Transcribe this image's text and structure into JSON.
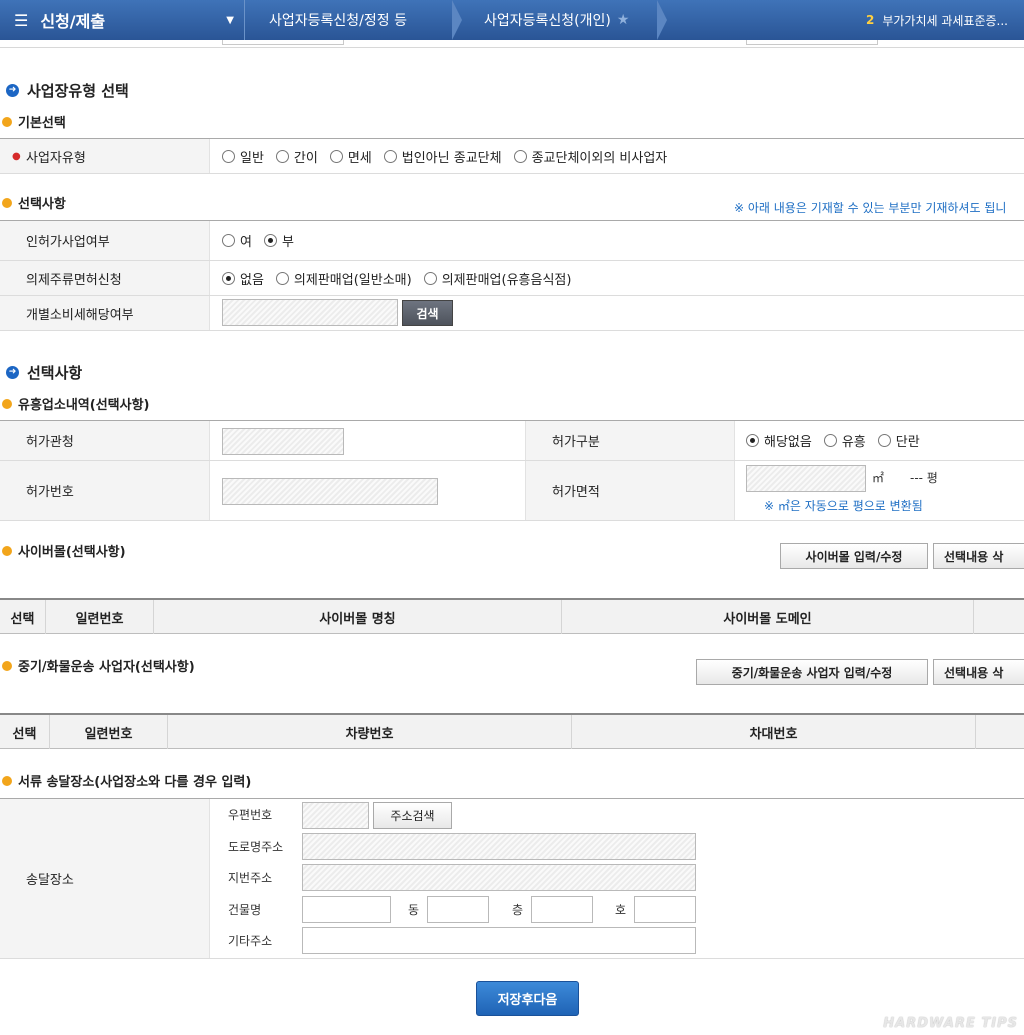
{
  "topbar": {
    "menu": "신청/제출",
    "crumb1": "사업자등록신청/정정 등",
    "crumb2": "사업자등록신청(개인)",
    "notice_num": "2",
    "notice_text": "부가가치세 과세표준증..."
  },
  "section1": {
    "title": "사업장유형 선택",
    "basic": "기본선택",
    "biz_type_label": "사업자유형",
    "biz_type_options": [
      "일반",
      "간이",
      "면세",
      "법인아닌 종교단체",
      "종교단체이외의 비사업자"
    ],
    "select_title": "선택사항",
    "select_note": "※ 아래 내용은 기재할 수 있는 부분만 기재하셔도 됩니",
    "license_label": "인허가사업여부",
    "license_opts": [
      "여",
      "부"
    ],
    "liquor_label": "의제주류면허신청",
    "liquor_opts": [
      "없음",
      "의제판매업(일반소매)",
      "의제판매업(유흥음식점)"
    ],
    "excise_label": "개별소비세해당여부",
    "search_btn": "검색"
  },
  "section2": {
    "title": "선택사항",
    "ent_title": "유흥업소내역(선택사항)",
    "agency_label": "허가관청",
    "permit_type_label": "허가구분",
    "permit_type_opts": [
      "해당없음",
      "유흥",
      "단란"
    ],
    "permit_no_label": "허가번호",
    "permit_area_label": "허가면적",
    "area_unit": "㎡",
    "pyeong": "--- 평",
    "area_note": "※ ㎡은 자동으로 평으로 변환됨",
    "cyber_title": "사이버몰(선택사항)",
    "cyber_btn": "사이버몰 입력/수정",
    "delete_btn": "선택내용 삭",
    "cyber_cols": [
      "선택",
      "일련번호",
      "사이버몰 명칭",
      "사이버몰 도메인"
    ],
    "truck_title": "중기/화물운송 사업자(선택사항)",
    "truck_btn": "중기/화물운송 사업자 입력/수정",
    "truck_cols": [
      "선택",
      "일련번호",
      "차량번호",
      "차대번호"
    ],
    "doc_title": "서류 송달장소(사업장소와 다를 경우 입력)",
    "delivery_label": "송달장소",
    "zip_label": "우편번호",
    "addr_search_btn": "주소검색",
    "road_label": "도로명주소",
    "jibun_label": "지번주소",
    "bldg_label": "건물명",
    "dong": "동",
    "floor": "층",
    "ho": "호",
    "etc_label": "기타주소"
  },
  "save_btn": "저장후다음",
  "watermark": "HARDWARE TIPS"
}
